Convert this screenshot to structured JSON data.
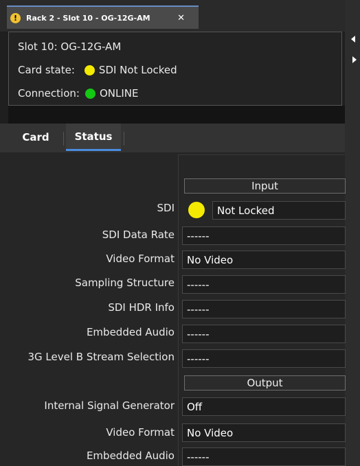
{
  "window": {
    "tab_title": "Rack 2 - Slot 10 - OG-12G-AM",
    "warning_icon_glyph": "!"
  },
  "info": {
    "slot": "Slot 10: OG-12G-AM",
    "card_state_label": "Card state:",
    "card_state_value": "SDI Not Locked",
    "card_state_color": "#f4ea00",
    "connection_label": "Connection:",
    "connection_value": "ONLINE",
    "connection_color": "#14c814"
  },
  "tabs": {
    "card": "Card",
    "status": "Status",
    "active": "Status"
  },
  "status": {
    "input_header": "Input",
    "sdi_label": "SDI",
    "sdi_value": "Not Locked",
    "sdi_data_rate_label": "SDI Data Rate",
    "sdi_data_rate_value": "------",
    "video_format_label": "Video Format",
    "video_format_value": "No Video",
    "sampling_label": "Sampling Structure",
    "sampling_value": "------",
    "hdr_label": "SDI HDR Info",
    "hdr_value": "------",
    "embedded_audio_label": "Embedded Audio",
    "embedded_audio_value": "------",
    "level_b_label": "3G Level B Stream Selection",
    "level_b_value": "------",
    "output_header": "Output",
    "signal_gen_label": "Internal Signal Generator",
    "signal_gen_value": "Off",
    "out_video_format_label": "Video Format",
    "out_video_format_value": "No Video",
    "out_embedded_audio_label": "Embedded Audio",
    "out_embedded_audio_value": "------"
  }
}
